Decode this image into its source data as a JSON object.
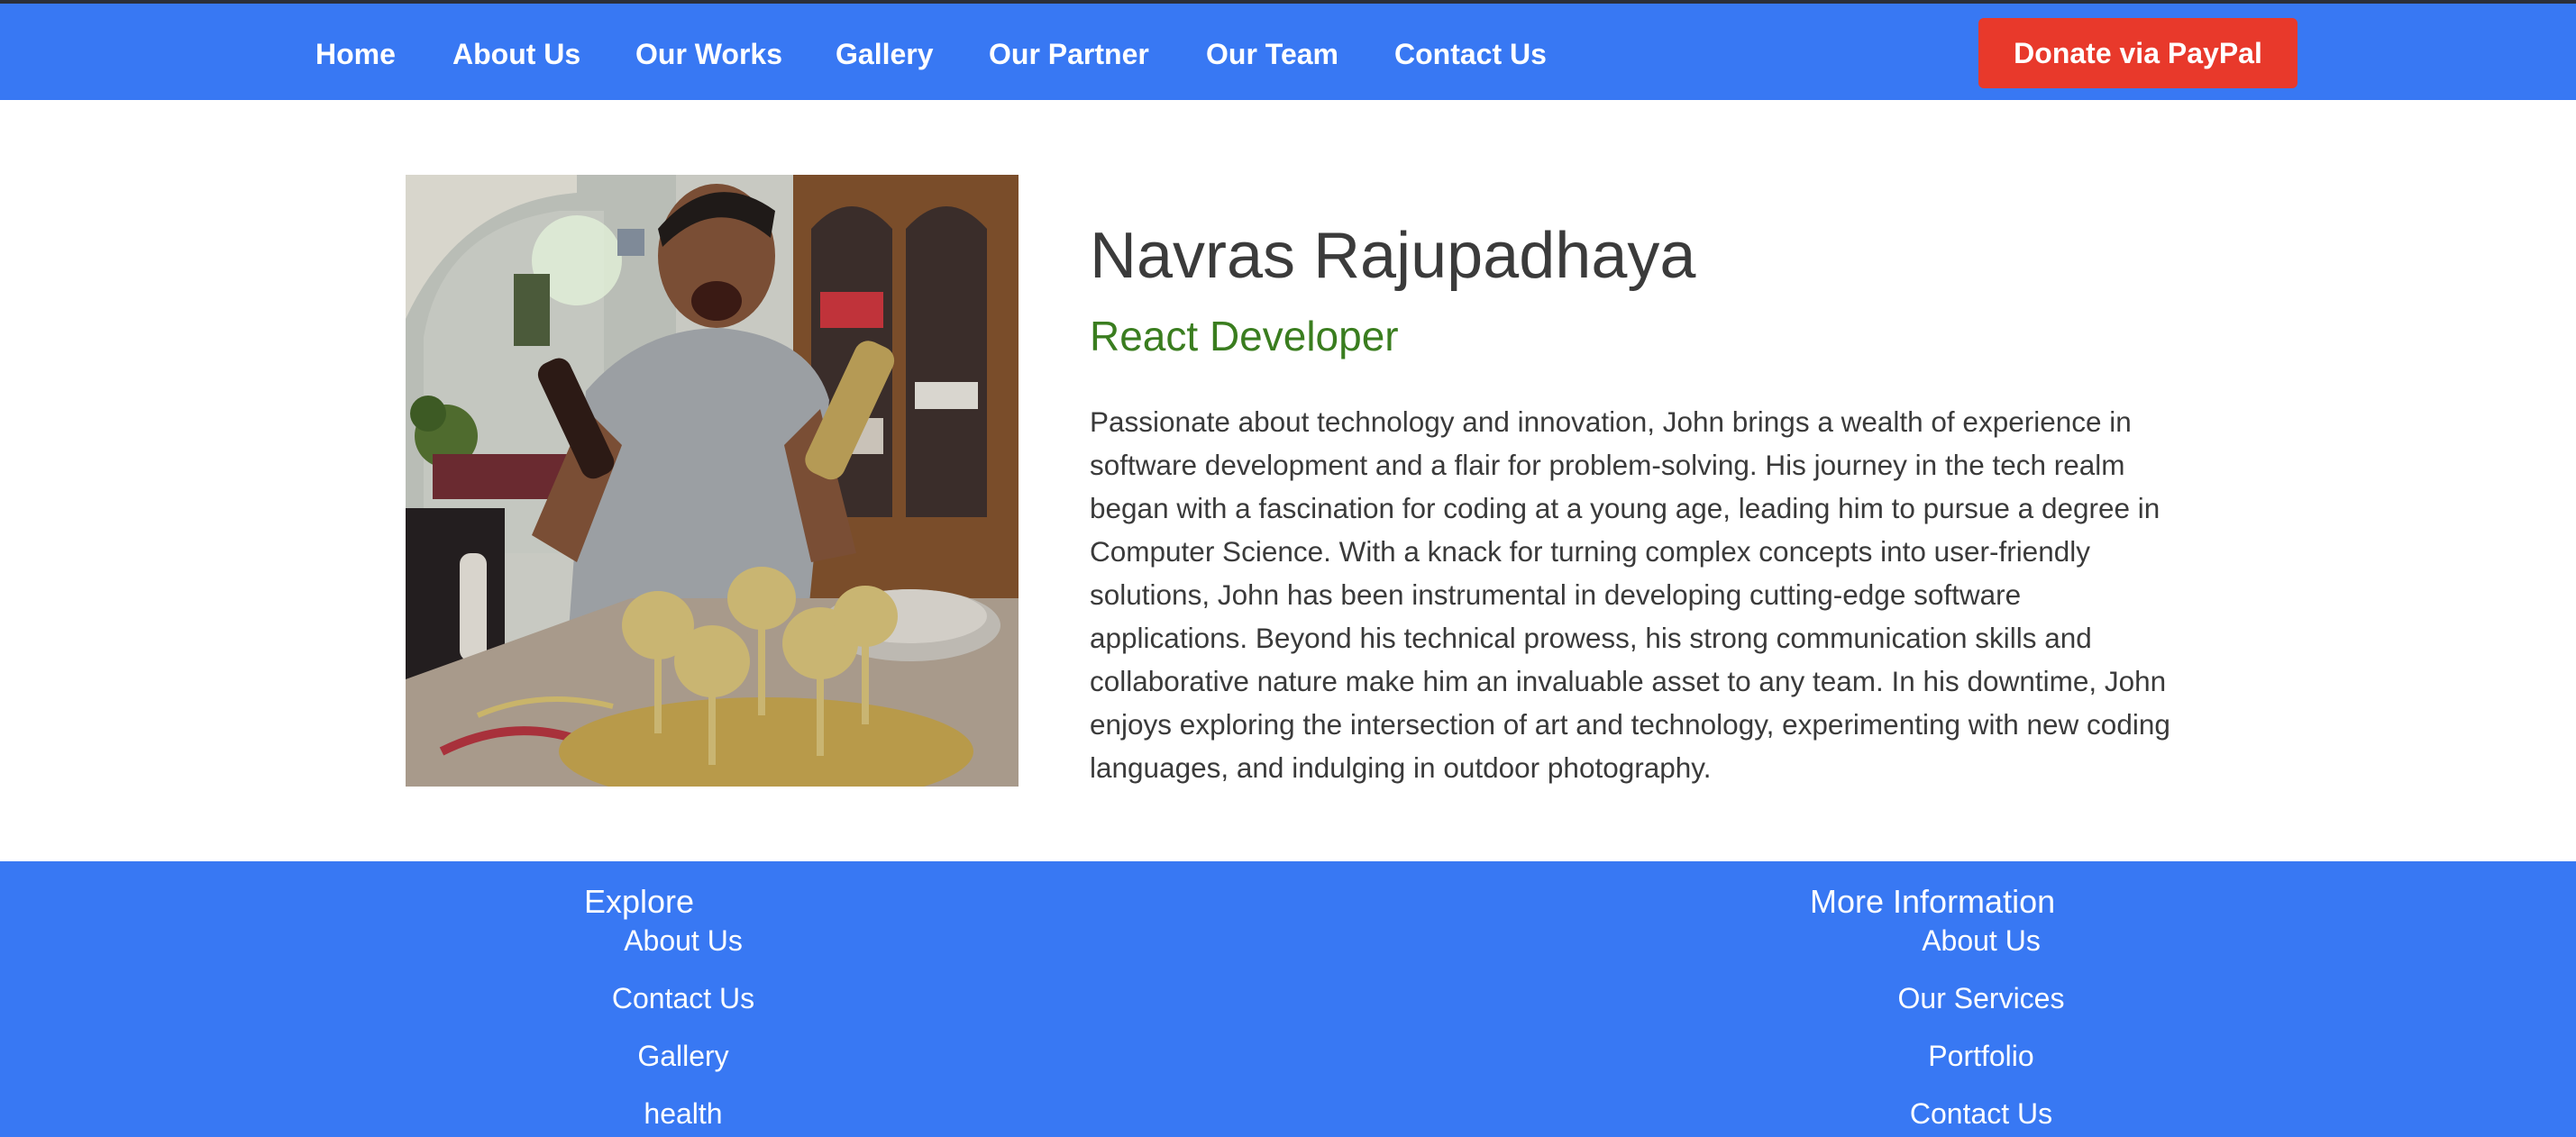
{
  "nav": {
    "items": [
      "Home",
      "About Us",
      "Our Works",
      "Gallery",
      "Our Partner",
      "Our Team",
      "Contact Us"
    ],
    "donate_label": "Donate via PayPal"
  },
  "member": {
    "name": "Navras Rajupadhaya",
    "role": "React Developer",
    "bio": "Passionate about technology and innovation, John brings a wealth of experience in software development and a flair for problem-solving. His journey in the tech realm began with a fascination for coding at a young age, leading him to pursue a degree in Computer Science. With a knack for turning complex concepts into user-friendly solutions, John has been instrumental in developing cutting-edge software applications. Beyond his technical prowess, his strong communication skills and collaborative nature make him an invaluable asset to any team. In his downtime, John enjoys exploring the intersection of art and technology, experimenting with new coding languages, and indulging in outdoor photography."
  },
  "footer": {
    "explore": {
      "heading": "Explore",
      "links": [
        "About Us",
        "Contact Us",
        "Gallery",
        "health"
      ]
    },
    "more_info": {
      "heading": "More Information",
      "links": [
        "About Us",
        "Our Services",
        "Portfolio",
        "Contact Us"
      ]
    }
  },
  "colors": {
    "brand_blue": "#3878f3",
    "donate_red": "#e8392b",
    "role_green": "#3a7d1f"
  }
}
